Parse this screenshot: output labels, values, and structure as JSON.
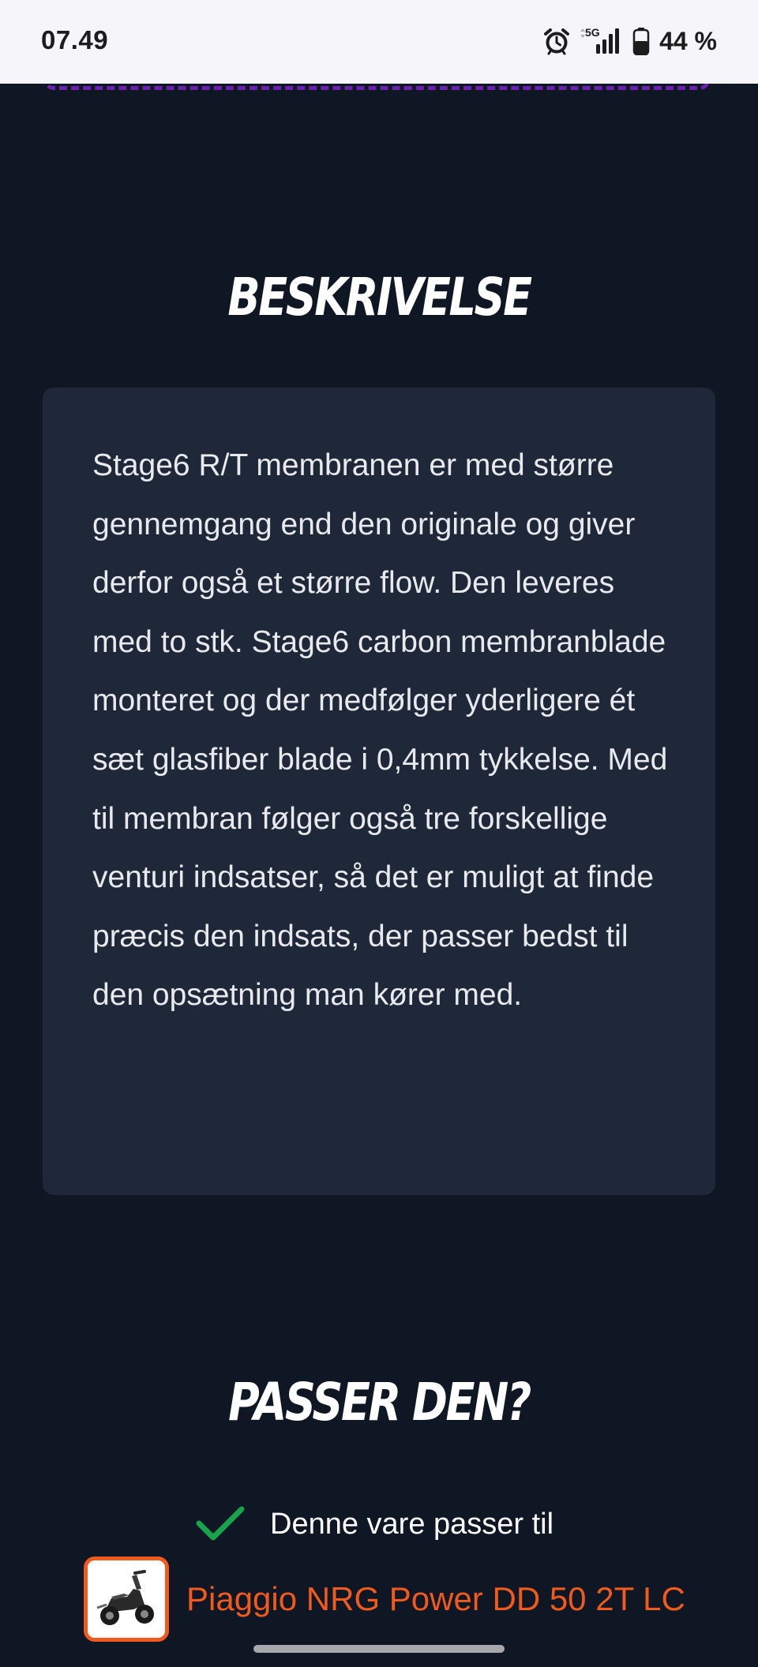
{
  "status_bar": {
    "time": "07.49",
    "network": "5G",
    "battery": "44 %",
    "icons": [
      "alarm-icon",
      "signal-icon",
      "battery-icon"
    ]
  },
  "description": {
    "heading": "BESKRIVELSE",
    "body": "Stage6 R/T membranen er med større gennemgang end den originale og giver derfor også et større flow. Den leveres med to stk. Stage6 carbon membranblade monteret og der medfølger yderligere ét sæt glasfiber blade i 0,4mm tykkelse. Med til membran følger også tre forskellige venturi indsatser, så det er muligt at finde præcis den indsats, der passer bedst til den opsætning man kører med."
  },
  "fitment": {
    "heading": "PASSER DEN?",
    "fits_text": "Denne vare passer til",
    "vehicle_name": "Piaggio NRG Power DD 50 2T LC"
  },
  "colors": {
    "background": "#0f1624",
    "card": "#1f2838",
    "accent_orange": "#ef5a1f",
    "check_green": "#19a34a",
    "dashed_purple": "#6d1fb0"
  }
}
